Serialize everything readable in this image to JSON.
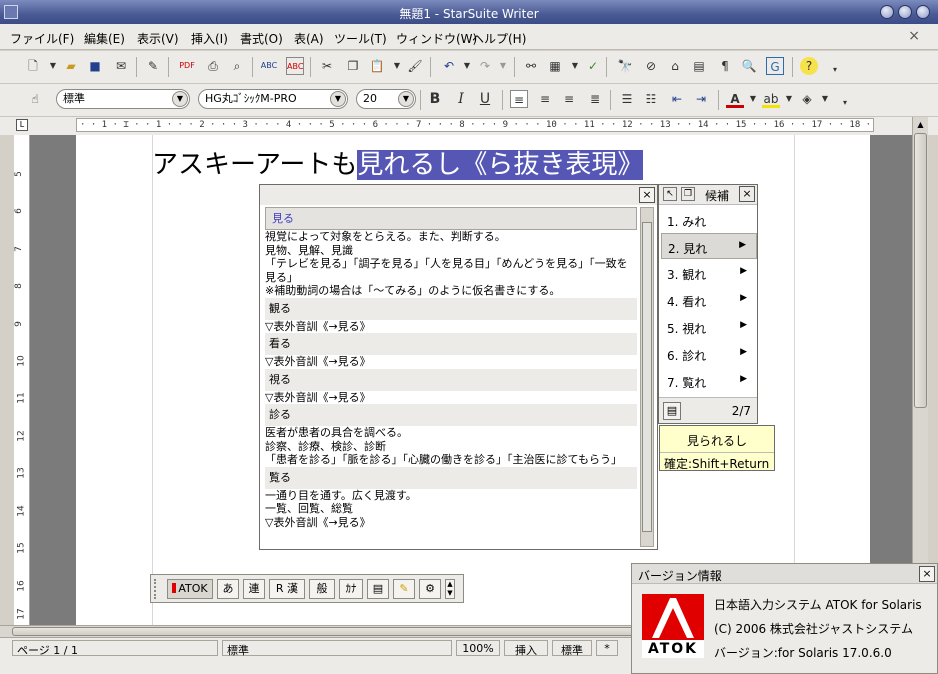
{
  "window": {
    "title": "無題1 - StarSuite Writer"
  },
  "menubar": {
    "items": [
      "ファイル(F)",
      "編集(E)",
      "表示(V)",
      "挿入(I)",
      "書式(O)",
      "表(A)",
      "ツール(T)",
      "ウィンドウ(W)",
      "ヘルプ(H)"
    ],
    "close": "×"
  },
  "formatbar": {
    "style": "標準",
    "font": "HG丸ｺﾞｼｯｸM-PRO",
    "size": "20",
    "bold": "B",
    "italic": "I",
    "underline": "U",
    "font_color": "A"
  },
  "ruler": {
    "ticks": "· · 1 · ⌶ · · 1 · · · 2 · · · 3 · · · 4 · · · 5 · · · 6 · · · 7 · · · 8 · · · 9 · · · 10 · · 11 · · 12 · · 13 · · 14 · · 15 · · 16 · · 17 · · 18 ·",
    "vertical": [
      "5",
      "6",
      "7",
      "8",
      "9",
      "10",
      "11",
      "12",
      "13",
      "14",
      "15",
      "16",
      "17"
    ]
  },
  "document": {
    "text_plain": "アスキーアートも",
    "text_selected": "見れるし《ら抜き表現》"
  },
  "dictionary": {
    "close": "×",
    "term": "見る",
    "definition": "視覚によって対象をとらえる。また、判断する。\n見物、見解、見識\n「テレビを見る」「調子を見る」「人を見る目」「めんどうを見る」「一致を見る」\n※補助動詞の場合は「～てみる」のように仮名書きにする。",
    "entries": [
      {
        "word": "観る",
        "text": "▽表外音訓《→見る》"
      },
      {
        "word": "看る",
        "text": "▽表外音訓《→見る》"
      },
      {
        "word": "視る",
        "text": "▽表外音訓《→見る》"
      },
      {
        "word": "診る",
        "text": "医者が患者の具合を調べる。\n診察、診療、検診、診断\n「患者を診る」「脈を診る」「心臓の働きを診る」「主治医に診てもらう」"
      },
      {
        "word": "覧る",
        "text": "一通り目を通す。広く見渡す。\n一覧、回覧、総覧\n▽表外音訓《→見る》"
      }
    ]
  },
  "candidates": {
    "title": "候補",
    "close": "×",
    "items": [
      "1. みれ",
      "2. 見れ",
      "3. 観れ",
      "4. 看れ",
      "5. 視れ",
      "6. 診れ",
      "7. 覧れ"
    ],
    "page": "2/7",
    "arrow": "▶"
  },
  "tooltip": {
    "suggestion": "見られるし",
    "hint": "確定:Shift+Return"
  },
  "atok_palette": {
    "buttons": [
      "ATOK",
      "あ",
      "連",
      "R 漢",
      "般",
      "ｶﾅ"
    ]
  },
  "statusbar": {
    "page": "ページ 1 / 1",
    "style": "標準",
    "zoom": "100%",
    "mode": "挿入",
    "sel_mode": "標準",
    "modified": "*"
  },
  "version_dialog": {
    "title": "バージョン情報",
    "close": "×",
    "logo_text": "ATOK",
    "line1": "日本語入力システム ATOK for Solaris",
    "line2": "(C) 2006 株式会社ジャストシステム",
    "line3": "バージョン:for Solaris 17.0.6.0"
  },
  "colors": {
    "selection": "#5657b4",
    "titlebar": "#4a5a94",
    "logo_red": "#e00000"
  }
}
